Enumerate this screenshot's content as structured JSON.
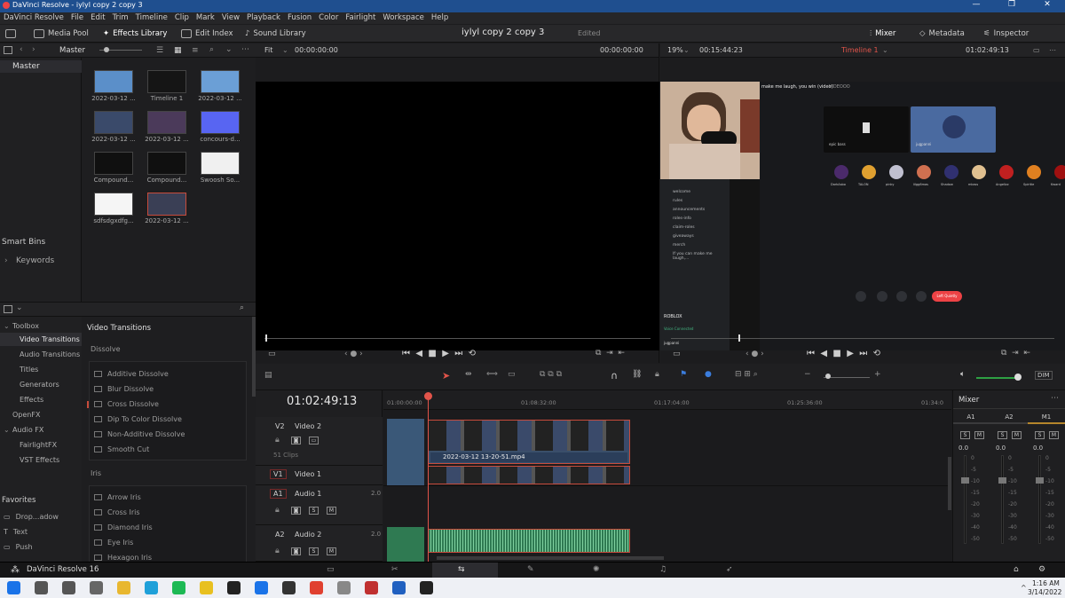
{
  "window": {
    "title": "DaVinci Resolve - iylyl copy 2 copy 3",
    "min": "—",
    "max": "❐",
    "close": "✕"
  },
  "menu": [
    "DaVinci Resolve",
    "File",
    "Edit",
    "Trim",
    "Timeline",
    "Clip",
    "Mark",
    "View",
    "Playback",
    "Fusion",
    "Color",
    "Fairlight",
    "Workspace",
    "Help"
  ],
  "toolbar": {
    "media_pool": "Media Pool",
    "effects_library": "Effects Library",
    "edit_index": "Edit Index",
    "sound_library": "Sound Library",
    "project_title": "iylyl copy 2 copy 3",
    "edited": "Edited",
    "mixer": "Mixer",
    "metadata": "Metadata",
    "inspector": "Inspector"
  },
  "media_pool": {
    "bin_label": "Master",
    "master": "Master",
    "smart_bins": "Smart Bins",
    "keywords": "Keywords",
    "clips": [
      {
        "name": "2022-03-12 ...",
        "color": "#5b8fc9"
      },
      {
        "name": "Timeline 1",
        "color": "#151515"
      },
      {
        "name": "2022-03-12 ...",
        "color": "#6b9fd6"
      },
      {
        "name": "2022-03-12 ...",
        "color": "#3a4a6a"
      },
      {
        "name": "2022-03-12 ...",
        "color": "#4b3a5a"
      },
      {
        "name": "concours-d...",
        "color": "#5865f2"
      },
      {
        "name": "Compound...",
        "color": "#101010"
      },
      {
        "name": "Compound...",
        "color": "#101010"
      },
      {
        "name": "Swoosh So...",
        "color": "#f0f0f0"
      },
      {
        "name": "sdfsdgxdfg...",
        "color": "#f5f5f5"
      },
      {
        "name": "2022-03-12 ...",
        "color": "#3a3f55"
      }
    ]
  },
  "source_viewer": {
    "zoom": "Fit",
    "timecode_left": "00:00:00:00",
    "timecode_right": "00:00:00:00"
  },
  "timeline_viewer": {
    "zoom": "19%",
    "duration": "00:15:44:23",
    "timeline_name": "Timeline 1",
    "timecode": "01:02:49:13"
  },
  "video_overlay": {
    "chat_title": "make me laugh, you win (video)",
    "chat_tag": "VIDEOOO",
    "tile_label": "epic bass",
    "tile_label2": "jugpanni",
    "channel_items": [
      "welcome",
      "rules",
      "announcements",
      "roles-info",
      "claim-roles",
      "giveaways",
      "merch",
      "If you can make me laugh,..."
    ],
    "voice_status": "Voice Connected",
    "user_names": [
      "DarkAsbo",
      "TALON",
      "pinky",
      "lilgg6mas",
      "Shadow",
      "mkass",
      "Angelizz",
      "Spiritie",
      "Kward",
      "OvMI"
    ],
    "server_tag": "ROBLOX",
    "bottom_user": "jugpanni",
    "leave_btn": "Left Quietly"
  },
  "effects": {
    "toolbox": "Toolbox",
    "tree": [
      "Video Transitions",
      "Audio Transitions",
      "Titles",
      "Generators",
      "Effects"
    ],
    "openfx": "OpenFX",
    "audio_fx": "Audio FX",
    "audio_fx_items": [
      "FairlightFX",
      "VST Effects"
    ],
    "list_title": "Video Transitions",
    "dissolve_header": "Dissolve",
    "dissolve": [
      "Additive Dissolve",
      "Blur Dissolve",
      "Cross Dissolve",
      "Dip To Color Dissolve",
      "Non-Additive Dissolve",
      "Smooth Cut"
    ],
    "iris_header": "Iris",
    "iris": [
      "Arrow Iris",
      "Cross Iris",
      "Diamond Iris",
      "Eye Iris",
      "Hexagon Iris"
    ]
  },
  "favorites": {
    "title": "Favorites",
    "items": [
      "Drop...adow",
      "Text",
      "Push"
    ]
  },
  "timeline": {
    "timecode": "01:02:49:13",
    "ruler": [
      "01:00:00:00",
      "01:08:32:00",
      "01:17:04:00",
      "01:25:36:00",
      "01:34:0"
    ],
    "tracks": [
      {
        "id": "V2",
        "name": "Video 2",
        "sub": "51 Clips"
      },
      {
        "id": "V1",
        "name": "Video 1",
        "sub": ""
      },
      {
        "id": "A1",
        "name": "Audio 1",
        "level": "2.0"
      },
      {
        "id": "A2",
        "name": "Audio 2",
        "level": "2.0"
      }
    ],
    "clip_label": "2022-03-12 13-20-51.mp4",
    "dim": "DIM"
  },
  "mixer": {
    "title": "Mixer",
    "channels": [
      "A1",
      "A2",
      "M1"
    ],
    "values": [
      "0.0",
      "0.0",
      "0.0"
    ],
    "scale": [
      "0",
      "-5",
      "-10",
      "-15",
      "-20",
      "-30",
      "-40",
      "-50"
    ],
    "s": "S",
    "m": "M"
  },
  "footer": {
    "app": "DaVinci Resolve 16"
  },
  "taskbar": {
    "time": "1:16 AM",
    "date": "3/14/2022",
    "chevron": "^"
  },
  "colors": {
    "accent_red": "#c74b3b",
    "titlebar": "#1f4f8f",
    "audio_green": "#2f7a52",
    "video_blue": "#3a4f6a"
  }
}
